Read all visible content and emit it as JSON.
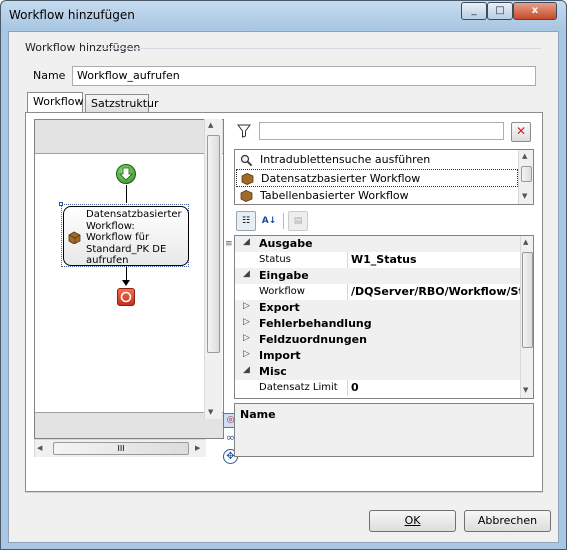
{
  "window": {
    "title": "Workflow hinzufügen",
    "minimize_label": "_",
    "maximize_label": "□",
    "close_label": "x"
  },
  "group": {
    "label": "Workflow hinzufügen"
  },
  "name_field": {
    "label": "Name",
    "value": "Workflow_aufrufen"
  },
  "tabs": [
    {
      "label": "Workflow"
    },
    {
      "label": "Satzstruktur"
    }
  ],
  "designer": {
    "start_node": "start",
    "node_lines": [
      "Datensatzbasierter",
      "Workflow:",
      "Workflow für",
      "Standard_PK DE",
      "aufrufen"
    ],
    "hscroll_thumb_label": "III",
    "vscroll_grip_label": "≡"
  },
  "filter": {
    "value": ""
  },
  "activities": [
    {
      "label": "Intradublettensuche ausführen",
      "icon": "search-icon"
    },
    {
      "label": "Datensatzbasierter Workflow",
      "icon": "box-icon",
      "selected": true
    },
    {
      "label": "Tabellenbasierter Workflow",
      "icon": "box-icon"
    }
  ],
  "properties": [
    {
      "type": "category",
      "name": "Ausgabe",
      "expanded": true
    },
    {
      "type": "property",
      "name": "Status",
      "value": "W1_Status"
    },
    {
      "type": "category",
      "name": "Eingabe",
      "expanded": true
    },
    {
      "type": "property",
      "name": "Workflow",
      "value": "/DQServer/RBO/Workflow/St"
    },
    {
      "type": "category",
      "name": "Export",
      "expanded": false
    },
    {
      "type": "category",
      "name": "Fehlerbehandlung",
      "expanded": false
    },
    {
      "type": "category",
      "name": "Feldzuordnungen",
      "expanded": false
    },
    {
      "type": "category",
      "name": "Import",
      "expanded": false
    },
    {
      "type": "category",
      "name": "Misc",
      "expanded": true
    },
    {
      "type": "property",
      "name": "Datensatz Limit",
      "value": "0"
    }
  ],
  "description": {
    "title": "Name"
  },
  "buttons": {
    "ok": "OK",
    "cancel": "Abbrechen"
  },
  "colors": {
    "start_green": "#3ca12c",
    "end_red": "#e04b2b",
    "accent": "#3399ff"
  }
}
